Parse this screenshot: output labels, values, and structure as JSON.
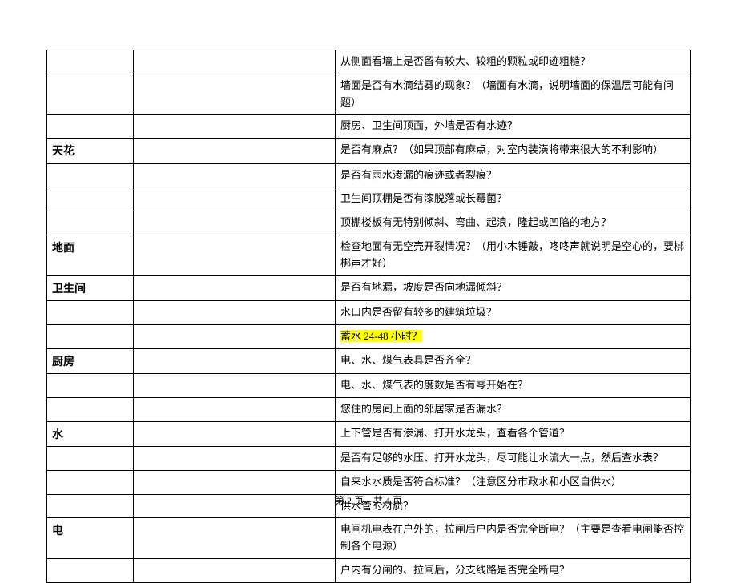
{
  "rows": [
    {
      "cat": "",
      "content": "从侧面看墙上是否留有较大、较粗的颗粒或印迹粗糙？"
    },
    {
      "cat": "",
      "content": "墙面是否有水滴结雾的现象？（墙面有水滴，说明墙面的保温层可能有问题）"
    },
    {
      "cat": "",
      "content": "厨房、卫生间顶面，外墙是否有水迹？"
    },
    {
      "cat": "天花",
      "content": "是否有麻点？（如果顶部有麻点，对室内装潢将带来很大的不利影响）"
    },
    {
      "cat": "",
      "content": "是否有雨水渗漏的痕迹或者裂痕？"
    },
    {
      "cat": "",
      "content": "卫生间顶棚是否有漆脱落或长霉菌？"
    },
    {
      "cat": "",
      "content": "顶棚楼板有无特别倾斜、弯曲、起浪，隆起或凹陷的地方？"
    },
    {
      "cat": "地面",
      "content": "检查地面有无空壳开裂情况？（用小木锤敲，咚咚声就说明是空心的，要梆梆声才好）"
    },
    {
      "cat": "卫生间",
      "content": "是否有地漏，坡度是否向地漏倾斜？"
    },
    {
      "cat": "",
      "content": "水口内是否留有较多的建筑垃圾？"
    },
    {
      "cat": "",
      "content": "蓄水 24-48 小时？",
      "highlight": true
    },
    {
      "cat": "厨房",
      "content": "电、水、煤气表具是否齐全？"
    },
    {
      "cat": "",
      "content": "电、水、煤气表的度数是否有零开始在？"
    },
    {
      "cat": "",
      "content": "您住的房间上面的邻居家是否漏水？"
    },
    {
      "cat": "水",
      "content": "上下管是否有渗漏、打开水龙头，查看各个管道？"
    },
    {
      "cat": "",
      "content": "是否有足够的水压、打开水龙头，尽可能让水流大一点，然后查水表？"
    },
    {
      "cat": "",
      "content": "自来水水质是否符合标准？（注意区分市政水和小区自供水）"
    },
    {
      "cat": "",
      "content": "供水管的材质？"
    },
    {
      "cat": "电",
      "content": "电闸机电表在户外的，拉闸后户内是否完全断电？（主要是查看电闸能否控制各个电源）"
    },
    {
      "cat": "",
      "content": "户内有分闸的、拉闸后，分支线路是否完全断电？"
    }
  ],
  "footer": "第 2 页，共 4 页"
}
